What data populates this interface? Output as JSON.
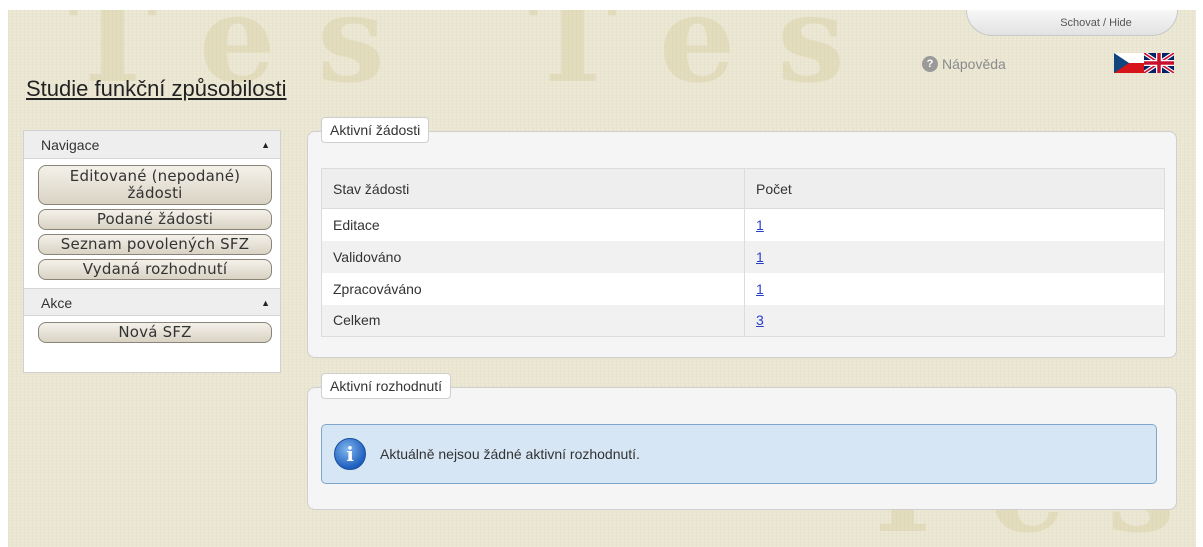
{
  "header": {
    "hide_label": "Schovat / Hide",
    "help_label": "Nápověda",
    "title": "Studie funkční způsobilosti"
  },
  "sidebar": {
    "navigation": {
      "heading": "Navigace",
      "items": [
        {
          "label": "Editované (nepodané) žádosti"
        },
        {
          "label": "Podané žádosti"
        },
        {
          "label": "Seznam povolených SFZ"
        },
        {
          "label": "Vydaná rozhodnutí"
        }
      ]
    },
    "actions": {
      "heading": "Akce",
      "items": [
        {
          "label": "Nová SFZ"
        }
      ]
    }
  },
  "active_requests": {
    "legend": "Aktivní žádosti",
    "columns": [
      "Stav žádosti",
      "Počet"
    ],
    "rows": [
      {
        "state": "Editace",
        "count": "1"
      },
      {
        "state": "Validováno",
        "count": "1"
      },
      {
        "state": "Zpracováváno",
        "count": "1"
      },
      {
        "state": "Celkem",
        "count": "3"
      }
    ]
  },
  "active_decisions": {
    "legend": "Aktivní rozhodnutí",
    "message": "Aktuálně nejsou žádné aktivní rozhodnutí."
  },
  "icons": {
    "help": "help-icon",
    "info": "info-icon",
    "collapse": "triangle-up-icon",
    "flags": [
      "czech-flag-icon",
      "uk-flag-icon"
    ]
  },
  "colors": {
    "background": "#ebe6d2",
    "link": "#2840c8",
    "info_box": "#d6e6f4"
  }
}
